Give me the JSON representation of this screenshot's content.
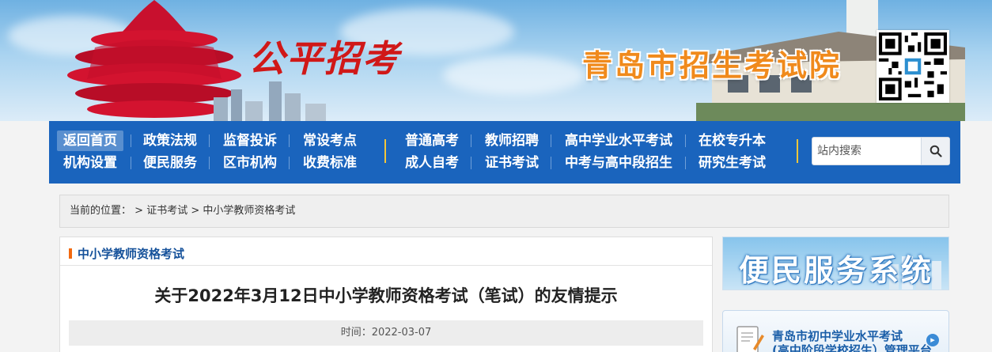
{
  "banner": {
    "slogan": "公平招考",
    "org_name": "青岛市招生考试院"
  },
  "nav": {
    "row1_left": [
      "返回首页",
      "政策法规",
      "监督投诉",
      "常设考点"
    ],
    "row2_left": [
      "机构设置",
      "便民服务",
      "区市机构",
      "收费标准"
    ],
    "row1_right": [
      "普通高考",
      "教师招聘",
      "高中学业水平考试",
      "在校专升本"
    ],
    "row2_right": [
      "成人自考",
      "证书考试",
      "中考与高中段招生",
      "研究生考试"
    ],
    "active": "返回首页",
    "search_placeholder": "站内搜索"
  },
  "breadcrumb": {
    "prefix": "当前的位置：",
    "sep1": ">",
    "item1": "证书考试",
    "sep2": ">",
    "item2": "中小学教师资格考试"
  },
  "panel": {
    "title": "中小学教师资格考试"
  },
  "article": {
    "title": "关于2022年3月12日中小学教师资格考试（笔试）的友情提示",
    "time_label": "时间：",
    "time_value": "2022-03-07"
  },
  "sidebar": {
    "service_banner": "便民服务系统",
    "system_line1": "青岛市初中学业水平考试",
    "system_line2": "(高中阶段学校招生）管理平台"
  },
  "colors": {
    "nav_bg": "#1a64bd",
    "accent_orange": "#f26a10",
    "title_blue": "#15519a",
    "org_title_orange": "#f08a1c",
    "slogan_red": "#d01818"
  }
}
